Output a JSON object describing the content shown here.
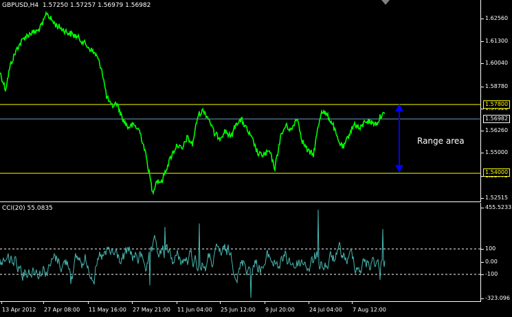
{
  "header": {
    "symbol": "GBPUSD,H4",
    "ohlc": "1.57250 1.57257 1.56979 1.56982"
  },
  "price_axis": {
    "labels": [
      "1.62560",
      "1.61300",
      "1.60040",
      "1.58780",
      "1.57520",
      "1.56260",
      "1.55000",
      "1.53775",
      "1.52515"
    ]
  },
  "horizontal_lines": {
    "upper": "1.57800",
    "lower": "1.54000",
    "current": "1.56982",
    "line_color": "#ffff00",
    "current_color": "#6fa0c8"
  },
  "annotation": {
    "text": "Range area",
    "arrow_color": "#0000ff"
  },
  "indicator": {
    "title": "CCI(20) 55.0835",
    "labels": [
      "455.5233",
      "100",
      "0.00",
      "-100",
      "-323.096"
    ],
    "line_color": "#48b8b0"
  },
  "time_axis": {
    "labels": [
      "13 Apr 2012",
      "27 Apr 08:00",
      "11 May 16:00",
      "27 May 21:00",
      "11 Jun 04:00",
      "25 Jun 12:00",
      "9 Jul 20:00",
      "24 Jul 04:00",
      "7 Aug 12:00"
    ]
  },
  "colors": {
    "price_line": "#00ff00",
    "background": "#000000",
    "axis": "#ffffff"
  }
}
